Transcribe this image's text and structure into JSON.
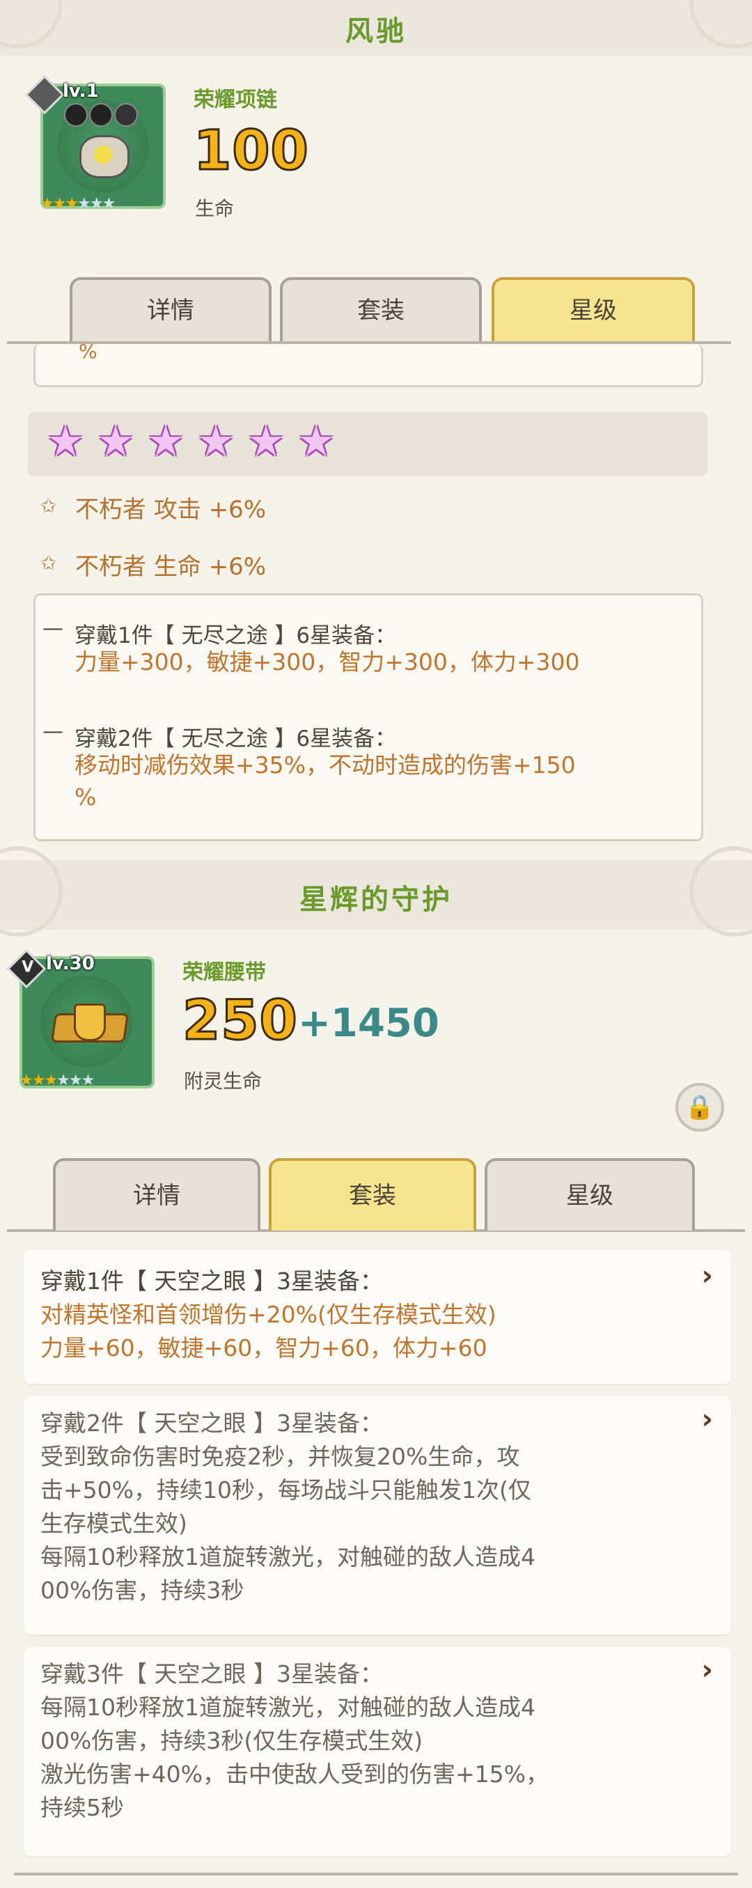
{
  "panel1": {
    "section_title": "风驰",
    "item": {
      "level": "lv.1",
      "name": "荣耀项链",
      "value": "100",
      "stat_label": "生命",
      "stars_filled": 3,
      "stars_total": 6
    },
    "tabs": [
      {
        "label": "详情",
        "active": false
      },
      {
        "label": "套装",
        "active": false
      },
      {
        "label": "星级",
        "active": true
      }
    ],
    "cut_text": "%",
    "star_count": 6,
    "star_bonuses": [
      "不朽者 攻击 +6%",
      "不朽者 生命 +6%"
    ],
    "set_effects": [
      {
        "title": "穿戴1件【 无尽之途 】6星装备：",
        "lines": [
          "力量+300，敏捷+300，智力+300，体力+300"
        ]
      },
      {
        "title": "穿戴2件【 无尽之途 】6星装备：",
        "lines": [
          "移动时减伤效果+35%，不动时造成的伤害+150",
          "%"
        ]
      }
    ]
  },
  "panel2": {
    "section_title": "星辉的守护",
    "item": {
      "level": "lv.30",
      "rank": "V",
      "name": "荣耀腰带",
      "value": "250",
      "bonus": "+1450",
      "stat_label": "附灵生命",
      "stars_filled": 3,
      "stars_total": 6
    },
    "tabs": [
      {
        "label": "详情",
        "active": false
      },
      {
        "label": "套装",
        "active": true
      },
      {
        "label": "星级",
        "active": false
      }
    ],
    "set_cards": [
      {
        "title": "穿戴1件【 天空之眼 】3星装备：",
        "lines": [
          "对精英怪和首领增伤+20%(仅生存模式生效)",
          "力量+60，敏捷+60，智力+60，体力+60"
        ]
      },
      {
        "title": "穿戴2件【 天空之眼 】3星装备：",
        "lines": [
          "受到致命伤害时免疫2秒，并恢复20%生命，攻",
          "击+50%，持续10秒，每场战斗只能触发1次(仅",
          "生存模式生效)",
          "每隔10秒释放1道旋转激光，对触碰的敌人造成4",
          "00%伤害，持续3秒"
        ]
      },
      {
        "title": "穿戴3件【 天空之眼 】3星装备：",
        "lines": [
          "每隔10秒释放1道旋转激光，对触碰的敌人造成4",
          "00%伤害，持续3秒(仅生存模式生效)",
          "激光伤害+40%，击中使敌人受到的伤害+15%，",
          "持续5秒"
        ]
      }
    ]
  },
  "colors": {
    "title_green": "#6a9a2a",
    "bonus_orange": "#c0752c",
    "active_tab": "#f6e58f",
    "teal": "#3a8a8a"
  }
}
